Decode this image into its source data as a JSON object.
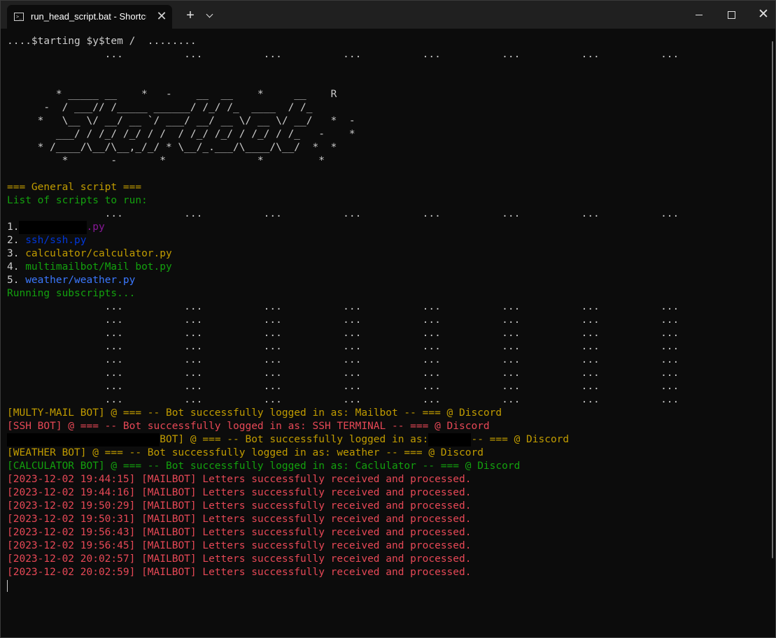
{
  "titlebar": {
    "tab_title": "run_head_script.bat - Shortcut",
    "tab_icon_glyph": ">_",
    "close_glyph": "✕",
    "new_tab_glyph": "+",
    "icons": [
      "terminal-icon",
      "close-icon",
      "plus-icon",
      "chevron-down-icon",
      "minimize-icon",
      "maximize-icon",
      "close-window-icon"
    ]
  },
  "colors": {
    "background": "#0c0c0c",
    "titlebar": "#202020",
    "white": "#cccccc",
    "yellow": "#c19c00",
    "green": "#13a10e",
    "red": "#e74856",
    "purple": "#881798",
    "blue": "#0037da",
    "light_blue": "#3b78ff"
  },
  "console": {
    "starting": "....$tarting $y$tem /  ........",
    "dots_row": "                ...          ...          ...          ...          ...          ...          ...          ...",
    "ascii_art": [
      "        * _____ __    *   -    __  __    *     __    R",
      "      -  / ___// /_____ ______/ /_/ /_  ____  / /_",
      "     *   \\__ \\/ __/ __ `/ ___/ __/ __ \\/ __ \\/ __/   *  -",
      "        ___/ / /_/ /_/ / /  / /_/ /_/ / /_/ / /_   -    *",
      "     * /____/\\__/\\__,_/_/ * \\__/_.___/\\____/\\__/  *  *",
      "         *       -       *               *         *"
    ],
    "general_header": "=== General script ===",
    "list_header": "List of scripts to run:",
    "scripts": [
      {
        "num": "1.",
        "name": ".py"
      },
      {
        "num": "2.",
        "name": "ssh/ssh.py"
      },
      {
        "num": "3.",
        "name": "calculator/calculator.py"
      },
      {
        "num": "4.",
        "name": "multimailbot/Mail bot.py"
      },
      {
        "num": "5.",
        "name": "weather/weather.py"
      }
    ],
    "running": "Running subscripts...",
    "bots": {
      "mail": "[MULTY-MAIL BOT] @ === -- Bot successfully logged in as: Mailbot -- === @ Discord",
      "ssh": "[SSH BOT] @ === -- Bot successfully logged in as: SSH TERMINAL -- === @ Discord",
      "redacted_start": "BOT] @ === -- Bot successfully logged in as:",
      "redacted_end": "-- === @ Discord",
      "weather": "[WEATHER BOT] @ === -- Bot successfully logged in as: weather -- === @ Discord",
      "calculator": "[CALCULATOR BOT] @ === -- Bot successfully logged in as: Caclulator -- === @ Discord"
    },
    "log_message": "[MAILBOT] Letters successfully received and processed.",
    "log_timestamps": [
      "[2023-12-02 19:44:15]",
      "[2023-12-02 19:44:16]",
      "[2023-12-02 19:50:29]",
      "[2023-12-02 19:50:31]",
      "[2023-12-02 19:56:43]",
      "[2023-12-02 19:56:45]",
      "[2023-12-02 20:02:57]",
      "[2023-12-02 20:02:59]"
    ]
  }
}
